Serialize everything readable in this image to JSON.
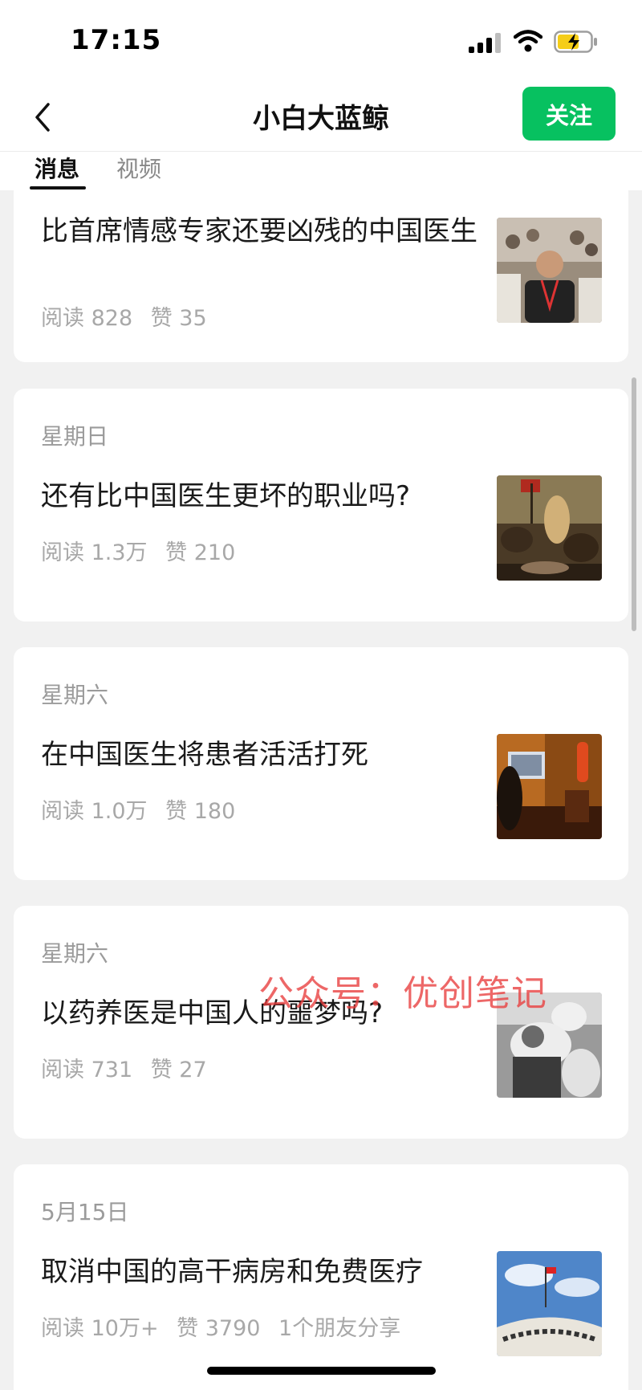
{
  "status_bar": {
    "time": "17:15",
    "signal_icon": "cellular-signal-icon",
    "wifi_icon": "wifi-icon",
    "battery_icon": "battery-charging-icon"
  },
  "nav": {
    "back_icon": "chevron-left-icon",
    "title": "小白大蓝鲸",
    "follow_label": "关注",
    "accent": "#07c160"
  },
  "tabs": [
    {
      "label": "消息",
      "active": true
    },
    {
      "label": "视频",
      "active": false
    }
  ],
  "articles": [
    {
      "date": "",
      "title": "比首席情感专家还要凶残的中国医生",
      "reads": "阅读 828",
      "likes": "赞 35",
      "shares": "",
      "thumbnail": "photo-man-at-conference"
    },
    {
      "date": "星期日",
      "title": "还有比中国医生更坏的职业吗?",
      "reads": "阅读 1.3万",
      "likes": "赞 210",
      "shares": "",
      "thumbnail": "painting-liberty-leading-the-people"
    },
    {
      "date": "星期六",
      "title": "在中国医生将患者活活打死",
      "reads": "阅读 1.0万",
      "likes": "赞 180",
      "shares": "",
      "thumbnail": "photo-hospital-room-tv"
    },
    {
      "date": "星期六",
      "title": "以药养医是中国人的噩梦吗?",
      "reads": "阅读 731",
      "likes": "赞 27",
      "shares": "",
      "thumbnail": "photo-black-white-patients"
    },
    {
      "date": "5月15日",
      "title": "取消中国的高干病房和免费医疗",
      "reads": "阅读 10万+",
      "likes": "赞 3790",
      "shares": "1个朋友分享",
      "thumbnail": "photo-building-with-flag"
    }
  ],
  "watermark": "公众号：优创笔记"
}
